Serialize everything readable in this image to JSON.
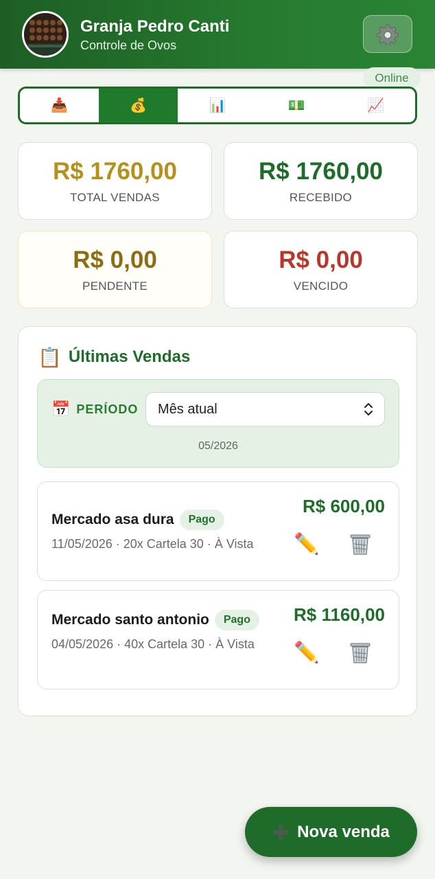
{
  "header": {
    "farm_name": "Granja Pedro Canti",
    "subtitle": "Controle de Ovos",
    "status": "Online",
    "settings_icon": "gear-icon",
    "avatar": "egg-trays-photo"
  },
  "tabs": [
    {
      "icon": "📥",
      "name": "inbox-tray-icon",
      "active": false
    },
    {
      "icon": "💰",
      "name": "money-bag-icon",
      "active": true
    },
    {
      "icon": "📊",
      "name": "bar-chart-icon",
      "active": false
    },
    {
      "icon": "💵",
      "name": "money-icon",
      "active": false
    },
    {
      "icon": "📈",
      "name": "chart-increasing-icon",
      "active": false
    }
  ],
  "stats": {
    "total": {
      "value": "R$ 1760,00",
      "label": "TOTAL VENDAS"
    },
    "received": {
      "value": "R$ 1760,00",
      "label": "RECEBIDO"
    },
    "pending": {
      "value": "R$ 0,00",
      "label": "PENDENTE"
    },
    "overdue": {
      "value": "R$ 0,00",
      "label": "VENCIDO"
    }
  },
  "sales_panel": {
    "icon": "📋",
    "title": "Últimas Vendas",
    "period": {
      "icon": "📅",
      "label": "PERÍODO",
      "selected": "Mês atual",
      "date": "05/2026"
    },
    "sales": [
      {
        "customer": "Mercado asa dura",
        "status": "Pago",
        "details": "11/05/2026 · 20x Cartela 30 · À Vista",
        "amount": "R$ 600,00"
      },
      {
        "customer": "Mercado santo antonio",
        "status": "Pago",
        "details": "04/05/2026 · 40x Cartela 30 · À Vista",
        "amount": "R$ 1160,00"
      }
    ]
  },
  "fab": {
    "label": "Nova venda"
  },
  "colors": {
    "primary": "#1f6b2a",
    "gold": "#b5901c",
    "danger": "#b7372c",
    "background": "#f3f5f1"
  }
}
